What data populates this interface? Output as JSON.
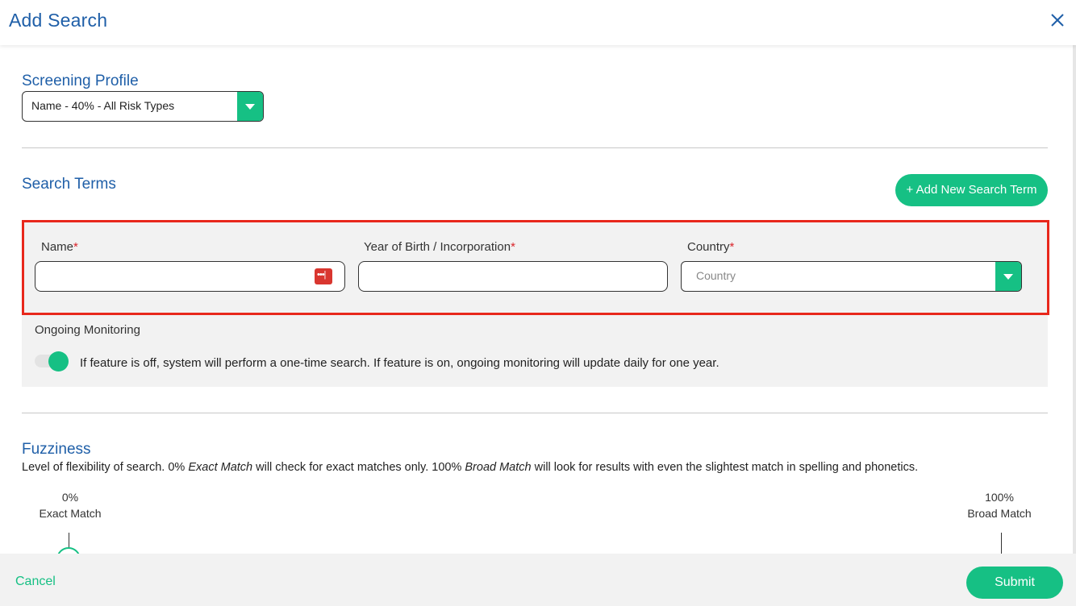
{
  "modal": {
    "title": "Add Search"
  },
  "screening_profile": {
    "title": "Screening Profile",
    "selected": "Name - 40% - All Risk Types"
  },
  "search_terms": {
    "title": "Search Terms",
    "add_button": "+ Add New Search Term",
    "fields": {
      "name": {
        "label": "Name",
        "required_mark": "*",
        "value": ""
      },
      "year_of_birth": {
        "label": "Year of Birth / Incorporation",
        "required_mark": "*",
        "value": ""
      },
      "country": {
        "label": "Country",
        "required_mark": "*",
        "placeholder": "Country"
      }
    },
    "ongoing_monitoring": {
      "label": "Ongoing Monitoring",
      "description": "If feature is off, system will perform a one-time search. If feature is on, ongoing monitoring will update daily for one year.",
      "enabled": true
    }
  },
  "fuzziness": {
    "title": "Fuzziness",
    "description_parts": [
      "Level of flexibility of search. 0% ",
      "Exact Match",
      " will check for exact matches only. 100% ",
      "Broad Match",
      " will look for results with even the slightest match in spelling and phonetics."
    ],
    "min_percent": "0%",
    "min_label": "Exact Match",
    "max_percent": "100%",
    "max_label": "Broad Match"
  },
  "footer": {
    "cancel": "Cancel",
    "submit": "Submit"
  },
  "colors": {
    "accent": "#16c084",
    "title_blue": "#1f5fa8",
    "highlight_red": "#e8281c",
    "required_red": "#d9262c"
  }
}
